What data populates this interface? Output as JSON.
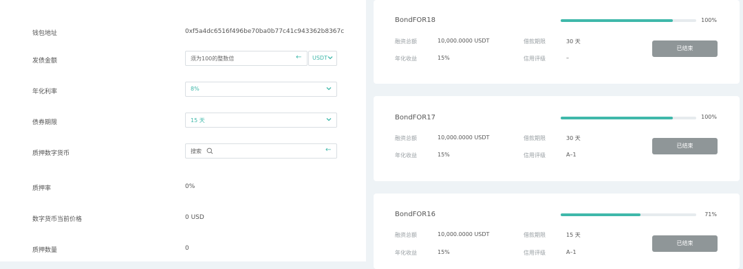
{
  "form": {
    "wallet_label": "钱包地址",
    "wallet_value": "0xf5a4dc6516f496be70ba0b77c41c943362b8367c",
    "issue_amount_label": "发债金额",
    "issue_amount_placeholder": "须为100的整数倍",
    "issue_amount_unit": "USDT",
    "rate_label": "年化利率",
    "rate_value": "8%",
    "term_label": "债券期限",
    "term_value": "15 天",
    "collateral_label": "质押数字货币",
    "collateral_search_placeholder": "搜索",
    "pledge_rate_label": "质押率",
    "pledge_rate_value": "0%",
    "price_label": "数字货币当前价格",
    "price_value": "0 USD",
    "pledge_qty_label": "质押数量",
    "pledge_qty_value": "0"
  },
  "bonds": [
    {
      "name": "BondFOR18",
      "progress_text": "100%",
      "progress": 1.0,
      "total_label": "融资总额",
      "total_value": "10,000.0000 USDT",
      "yield_label": "年化收益",
      "yield_value": "15%",
      "term_label": "借款期限",
      "term_value": "30 天",
      "rating_label": "信用评级",
      "rating_value": "–",
      "status": "已结束"
    },
    {
      "name": "BondFOR17",
      "progress_text": "100%",
      "progress": 1.0,
      "total_label": "融资总额",
      "total_value": "10,000.0000 USDT",
      "yield_label": "年化收益",
      "yield_value": "15%",
      "term_label": "借款期限",
      "term_value": "30 天",
      "rating_label": "信用评级",
      "rating_value": "A–1",
      "status": "已结束"
    },
    {
      "name": "BondFOR16",
      "progress_text": "71%",
      "progress": 0.71,
      "total_label": "融资总额",
      "total_value": "10,000.0000 USDT",
      "yield_label": "年化收益",
      "yield_value": "15%",
      "term_label": "借款期限",
      "term_value": "15 天",
      "rating_label": "信用评级",
      "rating_value": "A–1",
      "status": "已结束"
    }
  ],
  "colors": {
    "accent": "#3fb8aa",
    "status_button": "#8f9698",
    "background": "#eef3f6"
  }
}
